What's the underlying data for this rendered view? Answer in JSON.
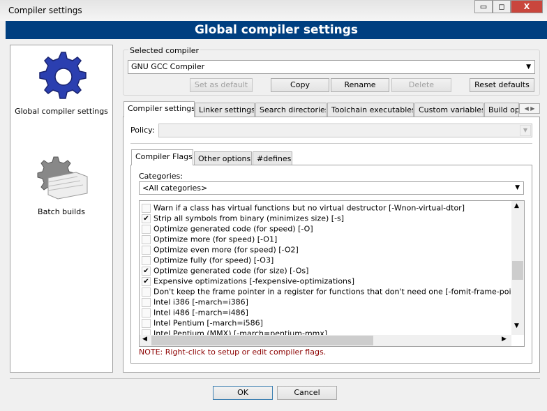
{
  "window": {
    "title": "Compiler settings",
    "minimize": "▭",
    "maximize": "◻",
    "close": "X"
  },
  "header": {
    "title": "Global compiler settings"
  },
  "sidebar": {
    "items": [
      {
        "label": "Global compiler settings",
        "icon": "gear-icon"
      },
      {
        "label": "Batch builds",
        "icon": "batch-gear-icon"
      }
    ]
  },
  "compiler_group": {
    "label": "Selected compiler",
    "selected": "GNU GCC Compiler",
    "buttons": {
      "set_default": "Set as default",
      "copy": "Copy",
      "rename": "Rename",
      "delete": "Delete",
      "reset": "Reset defaults"
    }
  },
  "tabs": [
    "Compiler settings",
    "Linker settings",
    "Search directories",
    "Toolchain executables",
    "Custom variables",
    "Build options"
  ],
  "policy": {
    "label": "Policy:",
    "value": ""
  },
  "inner_tabs": [
    "Compiler Flags",
    "Other options",
    "#defines"
  ],
  "categories": {
    "label": "Categories:",
    "selected": "<All categories>"
  },
  "flags": [
    {
      "label": "Warn if a class has virtual functions but no virtual destructor  [-Wnon-virtual-dtor]",
      "checked": false
    },
    {
      "label": "Strip all symbols from binary (minimizes size)  [-s]",
      "checked": true
    },
    {
      "label": "Optimize generated code (for speed)  [-O]",
      "checked": false
    },
    {
      "label": "Optimize more (for speed)  [-O1]",
      "checked": false
    },
    {
      "label": "Optimize even more (for speed)  [-O2]",
      "checked": false
    },
    {
      "label": "Optimize fully (for speed)  [-O3]",
      "checked": false
    },
    {
      "label": "Optimize generated code (for size)  [-Os]",
      "checked": true
    },
    {
      "label": "Expensive optimizations  [-fexpensive-optimizations]",
      "checked": true
    },
    {
      "label": "Don't keep the frame pointer in a register for functions that don't need one  [-fomit-frame-pointer]",
      "checked": false
    },
    {
      "label": "Intel i386  [-march=i386]",
      "checked": false
    },
    {
      "label": "Intel i486  [-march=i486]",
      "checked": false
    },
    {
      "label": "Intel Pentium  [-march=i586]",
      "checked": false
    },
    {
      "label": "Intel Pentium (MMX)  [-march=pentium-mmx]",
      "checked": false
    }
  ],
  "note": "NOTE: Right-click to setup or edit compiler flags.",
  "footer": {
    "ok": "OK",
    "cancel": "Cancel"
  },
  "colors": {
    "header": "#003f80",
    "note": "#8b0000"
  }
}
